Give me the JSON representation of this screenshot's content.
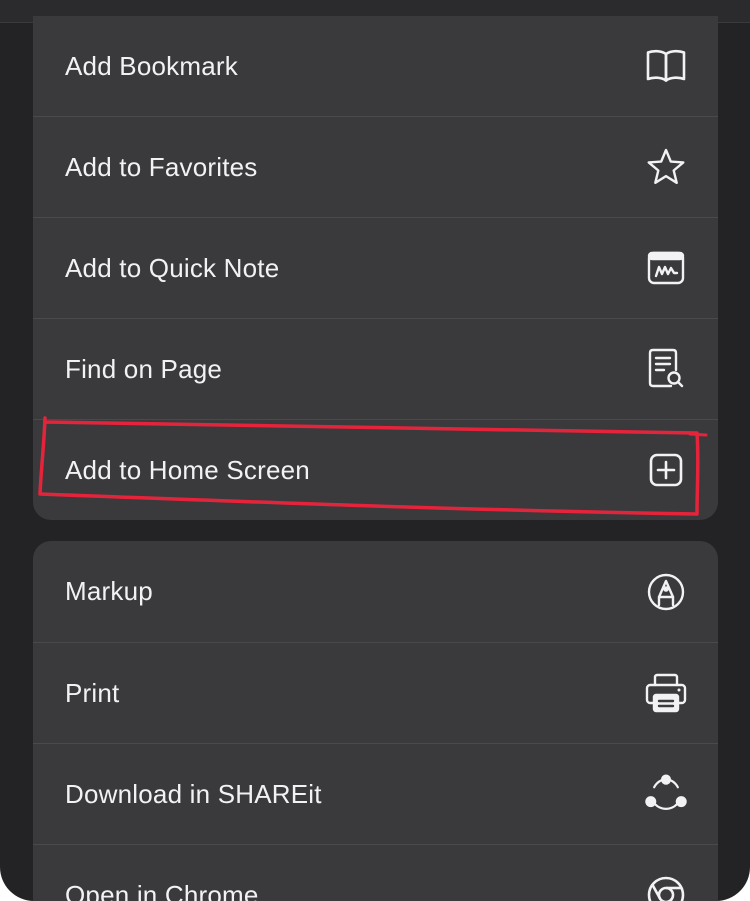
{
  "share_menu": {
    "group_one": [
      {
        "label": "Add Bookmark",
        "icon": "book-icon"
      },
      {
        "label": "Add to Favorites",
        "icon": "star-icon"
      },
      {
        "label": "Add to Quick Note",
        "icon": "quick-note-icon"
      },
      {
        "label": "Find on Page",
        "icon": "find-on-page-icon"
      },
      {
        "label": "Add to Home Screen",
        "icon": "plus-square-icon"
      }
    ],
    "group_two": [
      {
        "label": "Markup",
        "icon": "markup-pen-icon"
      },
      {
        "label": "Print",
        "icon": "printer-icon"
      },
      {
        "label": "Download in SHAREit",
        "icon": "shareit-icon"
      },
      {
        "label": "Open in Chrome",
        "icon": "chrome-icon"
      }
    ]
  },
  "annotation": {
    "highlighted_item": "Add to Home Screen",
    "color": "#e5243b"
  },
  "colors": {
    "sheet_background": "#232325",
    "row_background": "#3a3a3c",
    "separator": "#4a4a4d",
    "text": "#f2f2f5"
  }
}
